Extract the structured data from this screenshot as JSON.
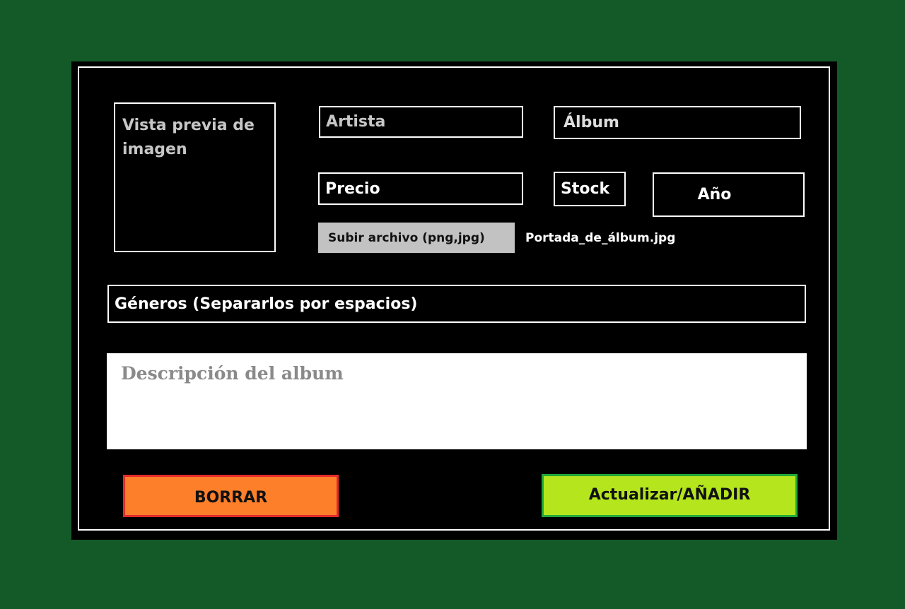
{
  "form": {
    "preview_label": "Vista previa de imagen",
    "artista_placeholder": "Artista",
    "album_placeholder": "Álbum",
    "precio_placeholder": "Precio",
    "stock_placeholder": "Stock",
    "anio_placeholder": "Año",
    "upload_label": "Subir archivo (png,jpg)",
    "file_name": "Portada_de_álbum.jpg",
    "generos_placeholder": "Géneros (Separarlos por espacios)",
    "descripcion_placeholder": "Descripción del album"
  },
  "actions": {
    "delete_label": "BORRAR",
    "submit_label": "Actualizar/AÑADIR"
  },
  "colors": {
    "background": "#145a28",
    "panel": "#000000",
    "delete_fill": "#fe7f2a",
    "delete_border": "#e32b2b",
    "submit_fill": "#b5e61d",
    "submit_border": "#21a838",
    "upload_fill": "#c2c2c2"
  }
}
